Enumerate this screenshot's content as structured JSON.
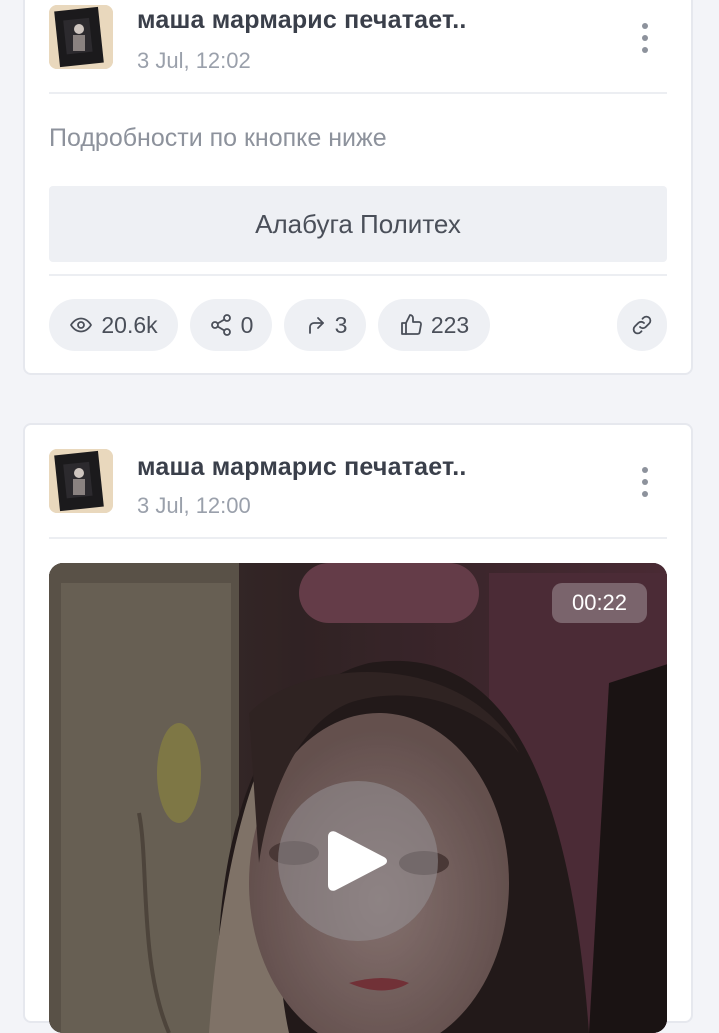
{
  "posts": [
    {
      "channel_name": "маша мармарис печатает..",
      "time": "3 Jul, 12:02",
      "text": "Подробности по кнопке ниже",
      "link_button_label": "Алабуга Политех",
      "stats": {
        "views": "20.6k",
        "shares": "0",
        "forwards": "3",
        "likes": "223"
      },
      "icons": {
        "views": "eye-icon",
        "shares": "share-nodes-icon",
        "forwards": "forward-arrow-icon",
        "likes": "thumbs-up-icon",
        "link": "chain-link-icon",
        "more": "vertical-dots-icon"
      }
    },
    {
      "channel_name": "маша мармарис печатает..",
      "time": "3 Jul, 12:00",
      "video": {
        "duration": "00:22",
        "play_icon": "play-icon"
      }
    }
  ],
  "colors": {
    "page_background": "#f3f4f8",
    "card_background": "#ffffff",
    "pill_background": "#eef0f4",
    "title_text": "#3a3f4a",
    "muted_text": "#9aa0ab"
  }
}
